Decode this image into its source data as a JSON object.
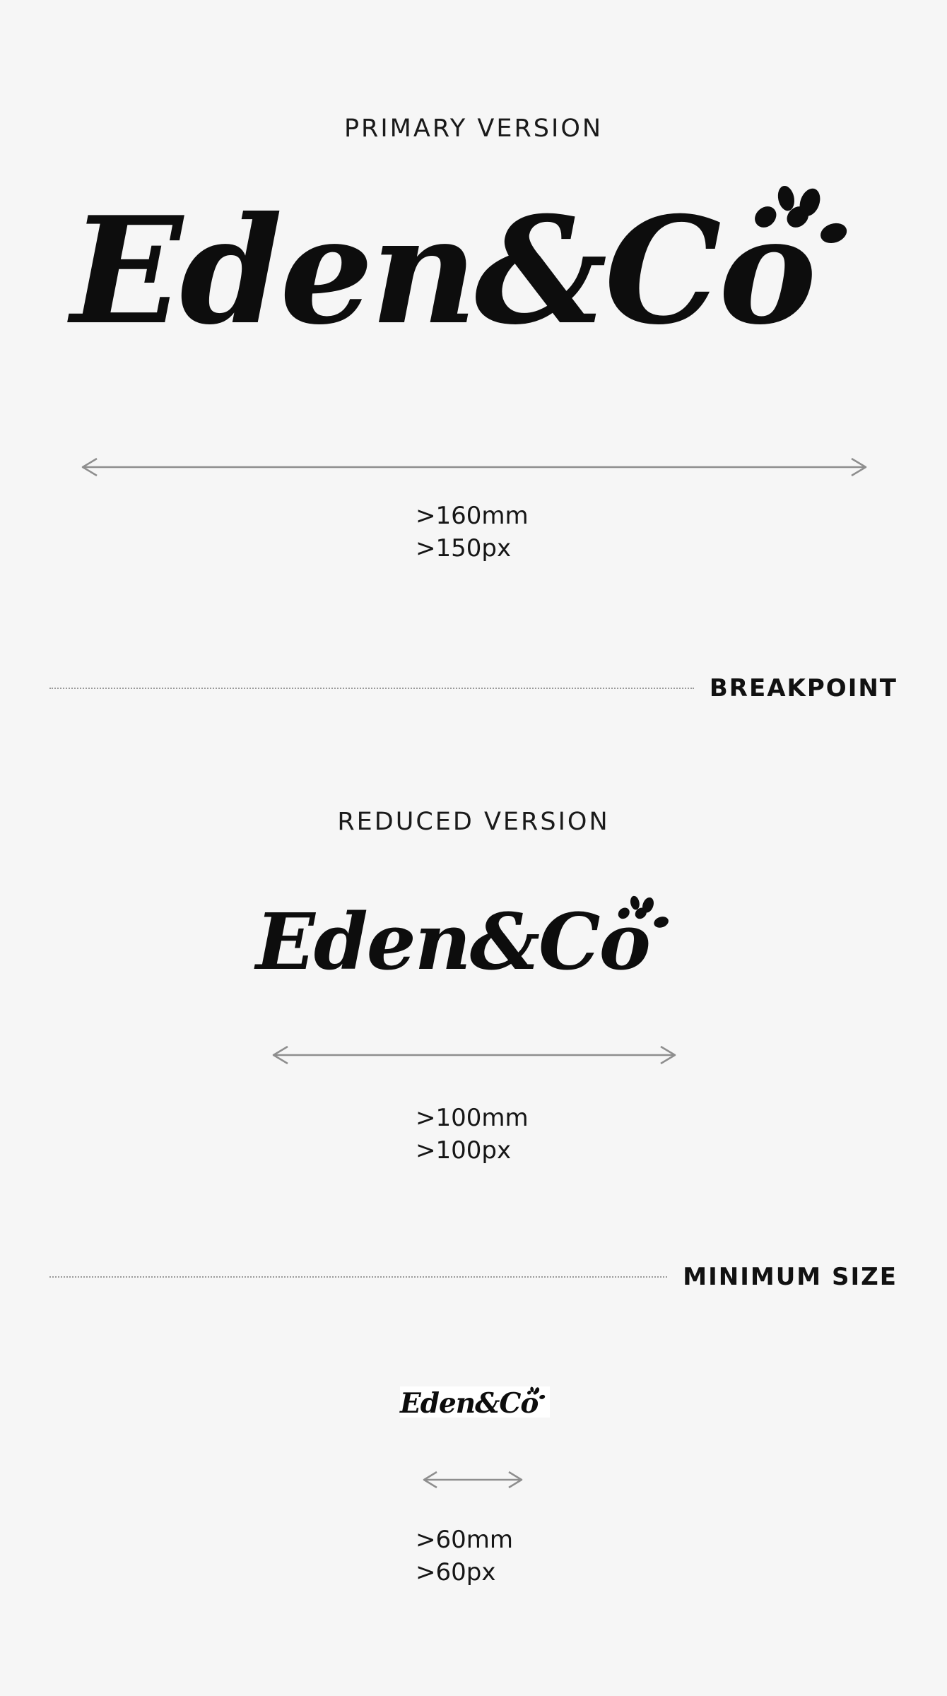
{
  "brand": {
    "logo_text": "Eden&Cö",
    "ink_color": "#0d0d0d"
  },
  "primary": {
    "title": "PRIMARY VERSION",
    "size_mm": ">160mm",
    "size_px": ">150px"
  },
  "breakpoint": {
    "label": "BREAKPOINT"
  },
  "reduced": {
    "title": "REDUCED VERSION",
    "size_mm": ">100mm",
    "size_px": ">100px"
  },
  "minimum": {
    "label": "MINIMUM SIZE",
    "size_mm": ">60mm",
    "size_px": ">60px"
  },
  "colors": {
    "background": "#f6f6f6",
    "arrow": "#8e8e8e",
    "divider": "#9a9a9a"
  },
  "icons": {
    "paw": "paw-icon",
    "arrow": "double-arrow-icon"
  }
}
